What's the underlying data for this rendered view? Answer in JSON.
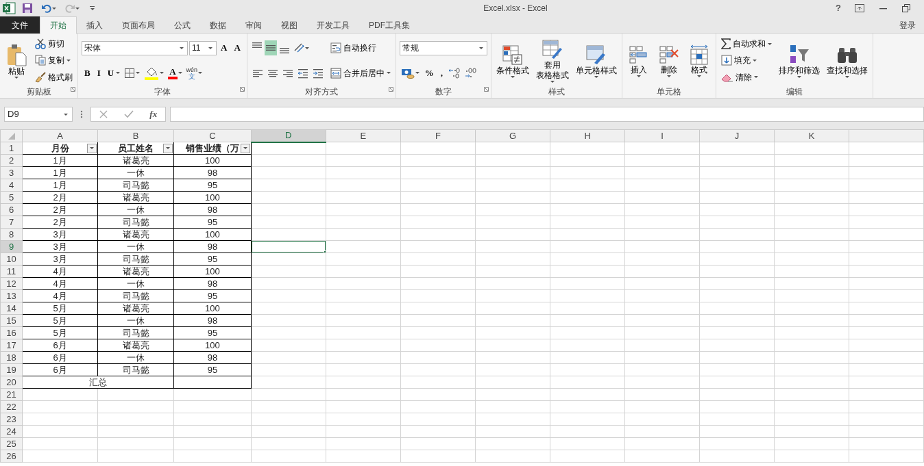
{
  "window": {
    "title": "Excel.xlsx - Excel",
    "help": "?"
  },
  "quick_access": [
    {
      "kind": "save",
      "disabled": false
    },
    {
      "kind": "undo",
      "disabled": false
    },
    {
      "kind": "redo",
      "disabled": true
    }
  ],
  "menu_tabs": [
    {
      "label": "文件",
      "kind": "file",
      "selected": false
    },
    {
      "label": "开始",
      "kind": "tab",
      "selected": true
    },
    {
      "label": "插入",
      "kind": "tab",
      "selected": false
    },
    {
      "label": "页面布局",
      "kind": "tab",
      "selected": false
    },
    {
      "label": "公式",
      "kind": "tab",
      "selected": false
    },
    {
      "label": "数据",
      "kind": "tab",
      "selected": false
    },
    {
      "label": "审阅",
      "kind": "tab",
      "selected": false
    },
    {
      "label": "视图",
      "kind": "tab",
      "selected": false
    },
    {
      "label": "开发工具",
      "kind": "tab",
      "selected": false
    },
    {
      "label": "PDF工具集",
      "kind": "tab",
      "selected": false
    }
  ],
  "sign_in": "登录",
  "ribbon": [
    {
      "name": "剪贴板",
      "launcher": true,
      "columns": [
        [
          [
            {
              "kind": "large",
              "label": "粘贴",
              "dropdown": true
            }
          ]
        ],
        [
          [
            {
              "kind": "small",
              "label": "剪切",
              "dropdown": false
            }
          ],
          [
            {
              "kind": "small",
              "label": "复制",
              "dropdown": true
            }
          ],
          [
            {
              "kind": "small",
              "label": "格式刷",
              "dropdown": false
            }
          ]
        ]
      ]
    },
    {
      "name": "字体",
      "launcher": true,
      "columns": [
        [
          [
            {
              "kind": "combo",
              "value": "宋体"
            },
            {
              "kind": "combo",
              "value": "11"
            },
            {
              "kind": "glyph",
              "label": "A",
              "dropdown": false
            },
            {
              "kind": "glyph",
              "label": "A",
              "dropdown": false
            }
          ],
          [
            {
              "kind": "glyph",
              "label": "B",
              "dropdown": false
            },
            {
              "kind": "glyph",
              "label": "I",
              "dropdown": false
            },
            {
              "kind": "glyph",
              "label": "U",
              "dropdown": true
            },
            {
              "kind": "tool",
              "dropdown": true,
              "selected": false
            },
            {
              "kind": "tool",
              "dropdown": true,
              "selected": false,
              "color": "#ffff00"
            },
            {
              "kind": "glyph",
              "label": "A",
              "dropdown": true,
              "color": "#ff0000"
            },
            {
              "kind": "ruby",
              "top": "wén",
              "bottom": "文",
              "dropdown": true
            }
          ]
        ]
      ]
    },
    {
      "name": "对齐方式",
      "launcher": true,
      "columns": [
        [
          [
            {
              "kind": "tool",
              "dropdown": false,
              "selected": false
            },
            {
              "kind": "tool",
              "dropdown": false,
              "selected": true
            },
            {
              "kind": "tool",
              "dropdown": false,
              "selected": false
            },
            {
              "kind": "tool",
              "dropdown": true,
              "selected": false
            }
          ],
          [
            {
              "kind": "tool",
              "dropdown": false,
              "selected": false
            },
            {
              "kind": "tool",
              "dropdown": false,
              "selected": false
            },
            {
              "kind": "tool",
              "dropdown": false,
              "selected": false
            },
            {
              "kind": "tool",
              "dropdown": false,
              "selected": false
            },
            {
              "kind": "tool",
              "dropdown": false,
              "selected": false
            }
          ]
        ],
        [
          [
            {
              "kind": "small",
              "label": "自动换行",
              "dropdown": false
            }
          ],
          [
            {
              "kind": "small",
              "label": "合并后居中",
              "dropdown": true
            }
          ]
        ]
      ]
    },
    {
      "name": "数字",
      "launcher": true,
      "columns": [
        [
          [
            {
              "kind": "combo",
              "value": "常规"
            }
          ],
          [
            {
              "kind": "tool",
              "dropdown": true,
              "selected": false
            },
            {
              "kind": "glyph",
              "label": "%",
              "dropdown": false
            },
            {
              "kind": "glyph",
              "label": ",",
              "dropdown": false
            },
            {
              "kind": "tool",
              "dropdown": false,
              "selected": false
            },
            {
              "kind": "tool",
              "dropdown": false,
              "selected": false
            }
          ]
        ]
      ]
    },
    {
      "name": "样式",
      "launcher": false,
      "columns": [
        [
          [
            {
              "kind": "large",
              "label": "条件格式",
              "dropdown": true
            }
          ]
        ],
        [
          [
            {
              "kind": "large",
              "lines": [
                "套用",
                "表格格式"
              ],
              "dropdown": true
            }
          ]
        ],
        [
          [
            {
              "kind": "large",
              "label": "单元格样式",
              "dropdown": true
            }
          ]
        ]
      ]
    },
    {
      "name": "单元格",
      "launcher": false,
      "columns": [
        [
          [
            {
              "kind": "large",
              "label": "插入",
              "dropdown": true
            }
          ]
        ],
        [
          [
            {
              "kind": "large",
              "label": "删除",
              "dropdown": true
            }
          ]
        ],
        [
          [
            {
              "kind": "large",
              "label": "格式",
              "dropdown": true
            }
          ]
        ]
      ]
    },
    {
      "name": "编辑",
      "launcher": false,
      "columns": [
        [
          [
            {
              "kind": "small",
              "label": "自动求和",
              "dropdown": true
            }
          ],
          [
            {
              "kind": "small",
              "label": "填充",
              "dropdown": true
            }
          ],
          [
            {
              "kind": "small",
              "label": "清除",
              "dropdown": true
            }
          ]
        ],
        [
          [
            {
              "kind": "large",
              "label": "排序和筛选",
              "dropdown": true
            }
          ]
        ],
        [
          [
            {
              "kind": "large",
              "label": "查找和选择",
              "dropdown": true
            }
          ]
        ]
      ]
    }
  ],
  "formula_bar": {
    "name_box": "D9",
    "function_button": "fx"
  },
  "sheet": {
    "columns": [
      {
        "label": "A",
        "selected": false
      },
      {
        "label": "B",
        "selected": false
      },
      {
        "label": "C",
        "selected": false
      },
      {
        "label": "D",
        "selected": true
      },
      {
        "label": "E",
        "selected": false
      },
      {
        "label": "F",
        "selected": false
      },
      {
        "label": "G",
        "selected": false
      },
      {
        "label": "H",
        "selected": false
      },
      {
        "label": "I",
        "selected": false
      },
      {
        "label": "J",
        "selected": false
      },
      {
        "label": "K",
        "selected": false
      }
    ],
    "row_numbers": [
      {
        "label": "1",
        "selected": false
      },
      {
        "label": "2",
        "selected": false
      },
      {
        "label": "3",
        "selected": false
      },
      {
        "label": "4",
        "selected": false
      },
      {
        "label": "5",
        "selected": false
      },
      {
        "label": "6",
        "selected": false
      },
      {
        "label": "7",
        "selected": false
      },
      {
        "label": "8",
        "selected": false
      },
      {
        "label": "9",
        "selected": true
      },
      {
        "label": "10",
        "selected": false
      },
      {
        "label": "11",
        "selected": false
      },
      {
        "label": "12",
        "selected": false
      },
      {
        "label": "13",
        "selected": false
      },
      {
        "label": "14",
        "selected": false
      },
      {
        "label": "15",
        "selected": false
      },
      {
        "label": "16",
        "selected": false
      },
      {
        "label": "17",
        "selected": false
      },
      {
        "label": "18",
        "selected": false
      },
      {
        "label": "19",
        "selected": false
      },
      {
        "label": "20",
        "selected": false
      },
      {
        "label": "21",
        "selected": false
      },
      {
        "label": "22",
        "selected": false
      },
      {
        "label": "23",
        "selected": false
      },
      {
        "label": "24",
        "selected": false
      },
      {
        "label": "25",
        "selected": false
      },
      {
        "label": "26",
        "selected": false
      }
    ],
    "table": [
      {
        "kind": "header",
        "cells": [
          "月份",
          "员工姓名",
          "销售业绩（万"
        ]
      },
      {
        "kind": "data",
        "cells": [
          "1月",
          "诸葛亮",
          "100"
        ]
      },
      {
        "kind": "data",
        "cells": [
          "1月",
          "一休",
          "98"
        ]
      },
      {
        "kind": "data",
        "cells": [
          "1月",
          "司马懿",
          "95"
        ]
      },
      {
        "kind": "data",
        "cells": [
          "2月",
          "诸葛亮",
          "100"
        ]
      },
      {
        "kind": "data",
        "cells": [
          "2月",
          "一休",
          "98"
        ]
      },
      {
        "kind": "data",
        "cells": [
          "2月",
          "司马懿",
          "95"
        ]
      },
      {
        "kind": "data",
        "cells": [
          "3月",
          "诸葛亮",
          "100"
        ]
      },
      {
        "kind": "data",
        "cells": [
          "3月",
          "一休",
          "98"
        ]
      },
      {
        "kind": "data",
        "cells": [
          "3月",
          "司马懿",
          "95"
        ]
      },
      {
        "kind": "data",
        "cells": [
          "4月",
          "诸葛亮",
          "100"
        ]
      },
      {
        "kind": "data",
        "cells": [
          "4月",
          "一休",
          "98"
        ]
      },
      {
        "kind": "data",
        "cells": [
          "4月",
          "司马懿",
          "95"
        ]
      },
      {
        "kind": "data",
        "cells": [
          "5月",
          "诸葛亮",
          "100"
        ]
      },
      {
        "kind": "data",
        "cells": [
          "5月",
          "一休",
          "98"
        ]
      },
      {
        "kind": "data",
        "cells": [
          "5月",
          "司马懿",
          "95"
        ]
      },
      {
        "kind": "data",
        "cells": [
          "6月",
          "诸葛亮",
          "100"
        ]
      },
      {
        "kind": "data",
        "cells": [
          "6月",
          "一休",
          "98"
        ]
      },
      {
        "kind": "data",
        "cells": [
          "6月",
          "司马懿",
          "95"
        ]
      },
      {
        "kind": "total",
        "cells": [
          "汇总"
        ]
      }
    ]
  }
}
